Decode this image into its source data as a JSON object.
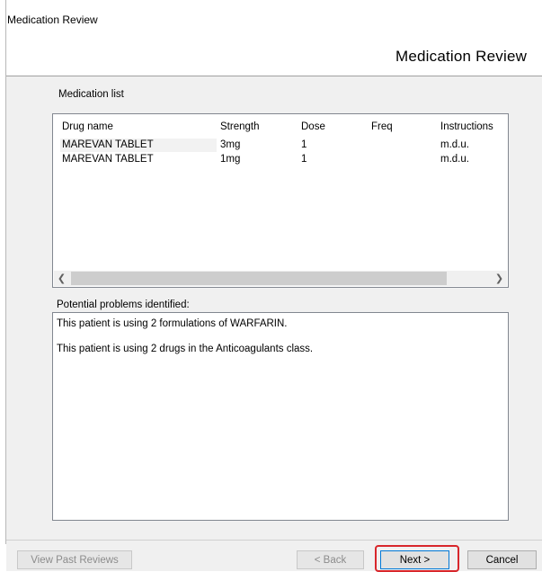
{
  "window": {
    "title": "Medication Review"
  },
  "header": {
    "heading": "Medication Review"
  },
  "medication_list": {
    "label": "Medication list",
    "columns": [
      "Drug name",
      "Strength",
      "Dose",
      "Freq",
      "Instructions"
    ],
    "rows": [
      {
        "drug_name": "MAREVAN TABLET",
        "strength": "3mg",
        "dose": "1",
        "freq": "",
        "instructions": "m.d.u."
      },
      {
        "drug_name": "MAREVAN TABLET",
        "strength": "1mg",
        "dose": "1",
        "freq": "",
        "instructions": "m.d.u."
      }
    ]
  },
  "problems": {
    "label": "Potential problems identified:",
    "lines": [
      "This patient is using 2 formulations of WARFARIN.",
      "This patient is using 2 drugs in the Anticoagulants class."
    ]
  },
  "footer": {
    "view_past_reviews": "View Past Reviews",
    "back": "< Back",
    "next": "Next >",
    "cancel": "Cancel"
  },
  "colors": {
    "highlight_ring": "#d8262b",
    "default_button_border": "#0078d7"
  }
}
